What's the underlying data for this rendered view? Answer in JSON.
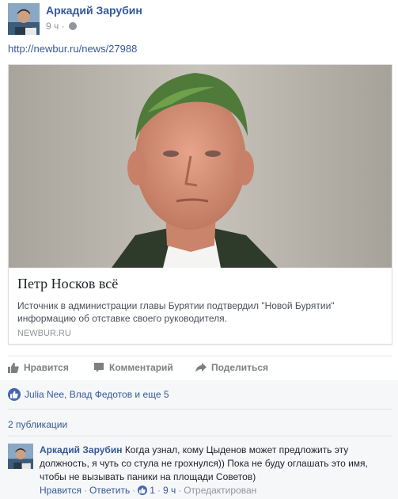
{
  "post": {
    "author": "Аркадий Зарубин",
    "time": "9 ч",
    "separator": "·",
    "privacy_icon": "globe-icon",
    "link": "http://newbur.ru/news/27988"
  },
  "card": {
    "title": "Петр Носков всё",
    "description": "Источник в администрации главы Бурятии подтвердил \"Новой Бурятии\" информацию об отставке своего руководителя.",
    "domain": "NEWBUR.RU"
  },
  "actions": {
    "like": "Нравится",
    "comment": "Комментарий",
    "share": "Поделиться"
  },
  "reactions": {
    "text": "Julia Nee, Влад Федотов и еще 5"
  },
  "shares": {
    "text": "2 публикации"
  },
  "comment": {
    "author": "Аркадий Зарубин",
    "text": "Когда узнал, кому Цыденов может предложить эту должность, я чуть со стула не грохнулся)) Пока не буду оглашать это имя, чтобы не вызывать паники на площади Советов)",
    "like_link": "Нравится",
    "dot": "·",
    "reply_link": "Ответить",
    "like_count": "1",
    "time": "9 ч",
    "edited": "Отредактирован"
  },
  "colors": {
    "link_blue": "#365899",
    "reaction_blue": "#4267b2",
    "muted_gray": "#90949c"
  }
}
